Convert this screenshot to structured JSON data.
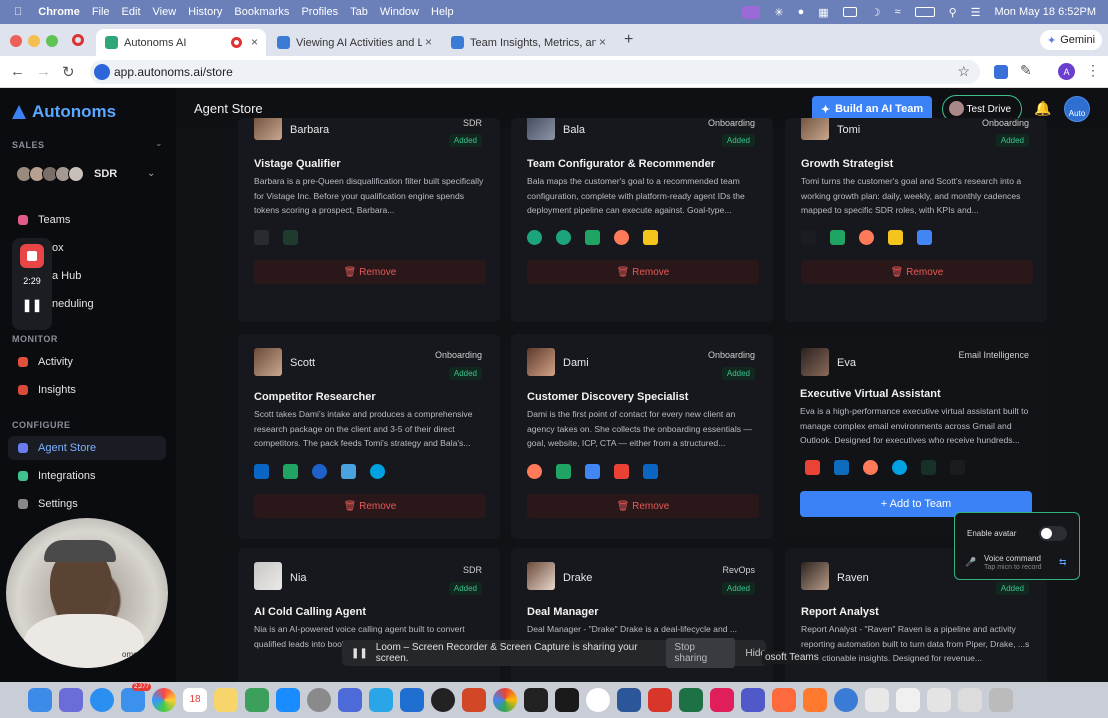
{
  "menubar": {
    "app": "Chrome",
    "items": [
      "File",
      "Edit",
      "View",
      "History",
      "Bookmarks",
      "Profiles",
      "Tab",
      "Window",
      "Help"
    ],
    "datetime": "Mon May 18  6:52PM"
  },
  "tabs": [
    {
      "label": "Autonoms AI"
    },
    {
      "label": "Viewing AI Activities and Live..."
    },
    {
      "label": "Team Insights, Metrics, and R..."
    }
  ],
  "gemini_label": "Gemini",
  "address": {
    "url": "app.autonoms.ai/store"
  },
  "profile_initial": "A",
  "sidebar": {
    "logo": "Autonoms",
    "sales_label": "SALES",
    "team_name": "SDR",
    "items_top": [
      {
        "label": "Teams"
      },
      {
        "label": "ox"
      },
      {
        "label": "a Hub"
      },
      {
        "label": "neduling"
      }
    ],
    "monitor_label": "MONITOR",
    "monitor_items": [
      {
        "label": "Activity"
      },
      {
        "label": "Insights"
      }
    ],
    "configure_label": "CONFIGURE",
    "configure_items": [
      {
        "label": "Agent Store"
      },
      {
        "label": "Integrations"
      },
      {
        "label": "Settings"
      }
    ]
  },
  "recorder": {
    "time": "2:29",
    "pause": "❚❚"
  },
  "header": {
    "title": "Agent Store",
    "build_label": "Build an AI Team",
    "test_label": "Test Drive",
    "avatar_text": "Auto"
  },
  "cards": [
    {
      "name": "Barbara",
      "role": "SDR",
      "status": "Added",
      "title": "Vistage Qualifier",
      "desc": "Barbara is a pre-Queen disqualification filter built specifically for Vistage Inc. Before your qualification engine spends tokens scoring a prospect, Barbara...",
      "action": "Remove"
    },
    {
      "name": "Bala",
      "role": "Onboarding",
      "status": "Added",
      "title": "Team Configurator & Recommender",
      "desc": "Bala maps the customer's goal to a recommended team configuration, complete with platform-ready agent IDs the deployment pipeline can execute against. Goal-type...",
      "action": "Remove"
    },
    {
      "name": "Tomi",
      "role": "Onboarding",
      "status": "Added",
      "title": "Growth Strategist",
      "desc": "Tomi turns the customer's goal and Scott's research into a working growth plan: daily, weekly, and monthly cadences mapped to specific SDR roles, with KPIs and...",
      "action": "Remove"
    },
    {
      "name": "Scott",
      "role": "Onboarding",
      "status": "Added",
      "title": "Competitor Researcher",
      "desc": "Scott takes Dami's intake and produces a comprehensive research package on the client and 3-5 of their direct competitors. The pack feeds Tomi's strategy and Bala's...",
      "action": "Remove"
    },
    {
      "name": "Dami",
      "role": "Onboarding",
      "status": "Added",
      "title": "Customer Discovery Specialist",
      "desc": "Dami is the first point of contact for every new client an agency takes on. She collects the onboarding essentials — goal, website, ICP, CTA — either from a structured...",
      "action": "Remove"
    },
    {
      "name": "Eva",
      "role": "Email Intelligence",
      "status": "",
      "title": "Executive Virtual Assistant",
      "desc": "Eva is a high-performance executive virtual assistant built to manage complex email environments across Gmail and Outlook. Designed for executives who receive hundreds...",
      "action": "+ Add to Team"
    },
    {
      "name": "Nia",
      "role": "SDR",
      "status": "Added",
      "title": "AI Cold Calling Agent",
      "desc": "Nia is an AI-powered voice calling agent built to convert qualified leads into booki... personalized phone co...",
      "action": "Remove"
    },
    {
      "name": "Drake",
      "role": "RevOps",
      "status": "Added",
      "title": "Deal Manager",
      "desc": "Deal Manager - \"Drake\" Drake is a deal-lifecycle and ...",
      "action": "Remove"
    },
    {
      "name": "Raven",
      "role": "",
      "status": "Added",
      "title": "Report Analyst",
      "desc": "Report Analyst - \"Raven\" Raven is a pipeline and activity reporting automation built to turn data from Piper, Drake, ...s into actionable insights. Designed for revenue...",
      "action": "Remove"
    }
  ],
  "avatar_panel": {
    "enable_label": "Enable avatar",
    "voice_label": "Voice command",
    "voice_sub": "Tap micn to record"
  },
  "sharebar": {
    "text": "Loom – Screen Recorder & Screen Capture is sharing your screen.",
    "stop_label": "Stop sharing",
    "hide_label": "Hide",
    "overlay": "osoft Teams"
  },
  "webcam_caption": "ome-",
  "dock": {
    "calendar_day": "18",
    "mail_badge": "2,277"
  },
  "colors": {
    "accent": "#3b82f6",
    "success": "#3fc28e",
    "danger": "#e55a5a"
  }
}
